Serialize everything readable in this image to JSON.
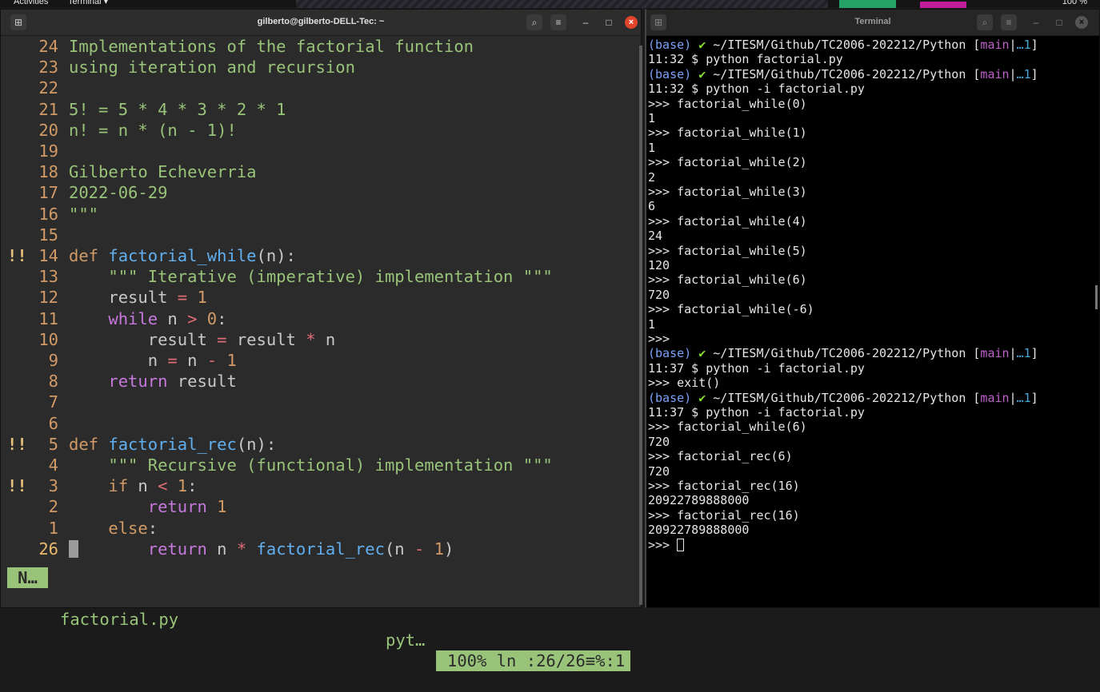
{
  "topbar": {
    "activities": "Activities",
    "app_menu": "Terminal ▾",
    "battery": "100 %"
  },
  "vim_window": {
    "title": "gilberto@gilberto-DELL-Tec: ~",
    "lines": [
      {
        "sign": "",
        "num": "24",
        "segs": [
          [
            "str",
            "Implementations of the factorial function"
          ]
        ]
      },
      {
        "sign": "",
        "num": "23",
        "segs": [
          [
            "str",
            "using iteration and recursion"
          ]
        ]
      },
      {
        "sign": "",
        "num": "22",
        "segs": []
      },
      {
        "sign": "",
        "num": "21",
        "segs": [
          [
            "str",
            "5! = 5 * 4 * 3 * 2 * 1"
          ]
        ]
      },
      {
        "sign": "",
        "num": "20",
        "segs": [
          [
            "str",
            "n! = n * (n - 1)!"
          ]
        ]
      },
      {
        "sign": "",
        "num": "19",
        "segs": []
      },
      {
        "sign": "",
        "num": "18",
        "segs": [
          [
            "str",
            "Gilberto Echeverria"
          ]
        ]
      },
      {
        "sign": "",
        "num": "17",
        "segs": [
          [
            "str",
            "2022-06-29"
          ]
        ]
      },
      {
        "sign": "",
        "num": "16",
        "segs": [
          [
            "str",
            "\"\"\""
          ]
        ]
      },
      {
        "sign": "",
        "num": "15",
        "segs": []
      },
      {
        "sign": "!!",
        "num": "14",
        "segs": [
          [
            "kw",
            "def "
          ],
          [
            "fn",
            "factorial_while"
          ],
          [
            "pun",
            "(n):"
          ]
        ]
      },
      {
        "sign": "",
        "num": "13",
        "segs": [
          [
            "str",
            "    \"\"\" Iterative (imperative) implementation \"\"\""
          ]
        ]
      },
      {
        "sign": "",
        "num": "12",
        "segs": [
          [
            "id",
            "    result "
          ],
          [
            "op",
            "="
          ],
          [
            "num",
            " 1"
          ]
        ]
      },
      {
        "sign": "",
        "num": "11",
        "segs": [
          [
            "kw2",
            "    while "
          ],
          [
            "id",
            "n "
          ],
          [
            "op",
            ">"
          ],
          [
            "num",
            " 0"
          ],
          [
            "pun",
            ":"
          ]
        ]
      },
      {
        "sign": "",
        "num": "10",
        "segs": [
          [
            "id",
            "        result "
          ],
          [
            "op",
            "="
          ],
          [
            "id",
            " result "
          ],
          [
            "op",
            "*"
          ],
          [
            "id",
            " n"
          ]
        ]
      },
      {
        "sign": "",
        "num": "9",
        "segs": [
          [
            "id",
            "        n "
          ],
          [
            "op",
            "="
          ],
          [
            "id",
            " n "
          ],
          [
            "op",
            "-"
          ],
          [
            "num",
            " 1"
          ]
        ]
      },
      {
        "sign": "",
        "num": "8",
        "segs": [
          [
            "kw2",
            "    return "
          ],
          [
            "id",
            "result"
          ]
        ]
      },
      {
        "sign": "",
        "num": "7",
        "segs": []
      },
      {
        "sign": "",
        "num": "6",
        "segs": []
      },
      {
        "sign": "!!",
        "num": "5",
        "segs": [
          [
            "kw",
            "def "
          ],
          [
            "fn",
            "factorial_rec"
          ],
          [
            "pun",
            "(n):"
          ]
        ]
      },
      {
        "sign": "",
        "num": "4",
        "segs": [
          [
            "str",
            "    \"\"\" Recursive (functional) implementation \"\"\""
          ]
        ]
      },
      {
        "sign": "!!",
        "num": "3",
        "segs": [
          [
            "kw",
            "    if "
          ],
          [
            "id",
            "n "
          ],
          [
            "op",
            "<"
          ],
          [
            "num",
            " 1"
          ],
          [
            "pun",
            ":"
          ]
        ]
      },
      {
        "sign": "",
        "num": "2",
        "segs": [
          [
            "kw2",
            "        return "
          ],
          [
            "num",
            "1"
          ]
        ]
      },
      {
        "sign": "",
        "num": "1",
        "segs": [
          [
            "kw",
            "    else"
          ],
          [
            "pun",
            ":"
          ]
        ]
      },
      {
        "sign": "",
        "num": "26",
        "cursor": true,
        "segs": [
          [
            "kw2",
            "        return "
          ],
          [
            "id",
            "n "
          ],
          [
            "op",
            "*"
          ],
          [
            "fn",
            " factorial_rec"
          ],
          [
            "pun",
            "(n "
          ],
          [
            "op",
            "-"
          ],
          [
            "num",
            " 1"
          ],
          [
            "pun",
            ")"
          ]
        ]
      }
    ],
    "status": {
      "mode": "N…",
      "filename": "factorial.py",
      "filetype": "pyt…",
      "position": "100% ln :26/26≡%:1"
    }
  },
  "term_window": {
    "title": "Terminal",
    "prompt": {
      "env": "(base)",
      "check": "✔",
      "path": "~/ITESM/Github/TC2006-202212/Python",
      "branch": "main",
      "dots": "…1"
    },
    "lines": [
      {
        "type": "prompt"
      },
      {
        "type": "text",
        "text": "11:32 $ python factorial.py"
      },
      {
        "type": "prompt"
      },
      {
        "type": "text",
        "text": "11:32 $ python -i factorial.py"
      },
      {
        "type": "text",
        "text": ">>> factorial_while(0)"
      },
      {
        "type": "text",
        "text": "1"
      },
      {
        "type": "text",
        "text": ">>> factorial_while(1)"
      },
      {
        "type": "text",
        "text": "1"
      },
      {
        "type": "text",
        "text": ">>> factorial_while(2)"
      },
      {
        "type": "text",
        "text": "2"
      },
      {
        "type": "text",
        "text": ">>> factorial_while(3)"
      },
      {
        "type": "text",
        "text": "6"
      },
      {
        "type": "text",
        "text": ">>> factorial_while(4)"
      },
      {
        "type": "text",
        "text": "24"
      },
      {
        "type": "text",
        "text": ">>> factorial_while(5)"
      },
      {
        "type": "text",
        "text": "120"
      },
      {
        "type": "text",
        "text": ">>> factorial_while(6)"
      },
      {
        "type": "text",
        "text": "720"
      },
      {
        "type": "text",
        "text": ">>> factorial_while(-6)"
      },
      {
        "type": "text",
        "text": "1"
      },
      {
        "type": "text",
        "text": ">>>"
      },
      {
        "type": "prompt"
      },
      {
        "type": "text",
        "text": "11:37 $ python -i factorial.py"
      },
      {
        "type": "text",
        "text": ">>> exit()"
      },
      {
        "type": "prompt"
      },
      {
        "type": "text",
        "text": "11:37 $ python -i factorial.py"
      },
      {
        "type": "text",
        "text": ">>> factorial_while(6)"
      },
      {
        "type": "text",
        "text": "720"
      },
      {
        "type": "text",
        "text": ">>> factorial_rec(6)"
      },
      {
        "type": "text",
        "text": "720"
      },
      {
        "type": "text",
        "text": ">>> factorial_rec(16)"
      },
      {
        "type": "text",
        "text": "20922789888000"
      },
      {
        "type": "text",
        "text": ">>> factorial_rec(16)"
      },
      {
        "type": "text",
        "text": "20922789888000"
      },
      {
        "type": "cursor",
        "text": ">>> "
      }
    ]
  }
}
